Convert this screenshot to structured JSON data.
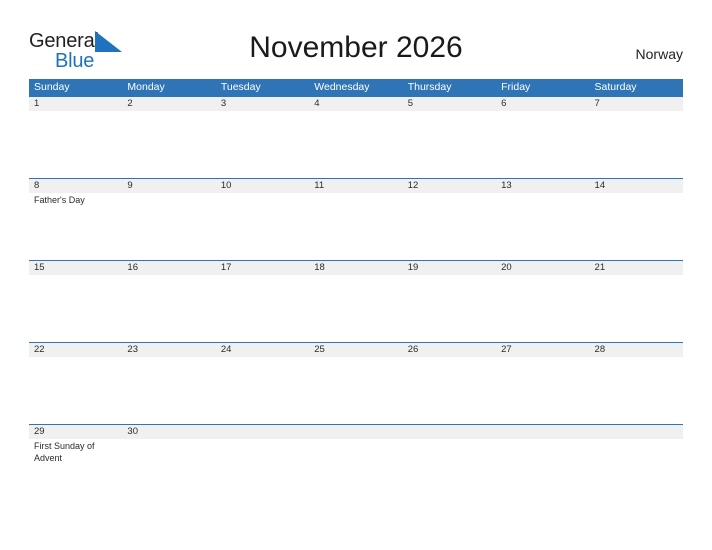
{
  "brand": {
    "name_part1": "General",
    "name_part2": "Blue",
    "mark": "triangle-flag-mark",
    "accent_color": "#1f72bd"
  },
  "header": {
    "title": "November 2026",
    "country": "Norway"
  },
  "calendar": {
    "header_color": "#2f75b5",
    "daynum_band_color": "#f0f0f0",
    "weekdays": [
      "Sunday",
      "Monday",
      "Tuesday",
      "Wednesday",
      "Thursday",
      "Friday",
      "Saturday"
    ],
    "weeks": [
      {
        "days": [
          {
            "num": "1",
            "event": ""
          },
          {
            "num": "2",
            "event": ""
          },
          {
            "num": "3",
            "event": ""
          },
          {
            "num": "4",
            "event": ""
          },
          {
            "num": "5",
            "event": ""
          },
          {
            "num": "6",
            "event": ""
          },
          {
            "num": "7",
            "event": ""
          }
        ]
      },
      {
        "days": [
          {
            "num": "8",
            "event": "Father's Day"
          },
          {
            "num": "9",
            "event": ""
          },
          {
            "num": "10",
            "event": ""
          },
          {
            "num": "11",
            "event": ""
          },
          {
            "num": "12",
            "event": ""
          },
          {
            "num": "13",
            "event": ""
          },
          {
            "num": "14",
            "event": ""
          }
        ]
      },
      {
        "days": [
          {
            "num": "15",
            "event": ""
          },
          {
            "num": "16",
            "event": ""
          },
          {
            "num": "17",
            "event": ""
          },
          {
            "num": "18",
            "event": ""
          },
          {
            "num": "19",
            "event": ""
          },
          {
            "num": "20",
            "event": ""
          },
          {
            "num": "21",
            "event": ""
          }
        ]
      },
      {
        "days": [
          {
            "num": "22",
            "event": ""
          },
          {
            "num": "23",
            "event": ""
          },
          {
            "num": "24",
            "event": ""
          },
          {
            "num": "25",
            "event": ""
          },
          {
            "num": "26",
            "event": ""
          },
          {
            "num": "27",
            "event": ""
          },
          {
            "num": "28",
            "event": ""
          }
        ]
      },
      {
        "days": [
          {
            "num": "29",
            "event": "First Sunday of Advent"
          },
          {
            "num": "30",
            "event": ""
          },
          {
            "num": "",
            "event": ""
          },
          {
            "num": "",
            "event": ""
          },
          {
            "num": "",
            "event": ""
          },
          {
            "num": "",
            "event": ""
          },
          {
            "num": "",
            "event": ""
          }
        ]
      }
    ]
  }
}
